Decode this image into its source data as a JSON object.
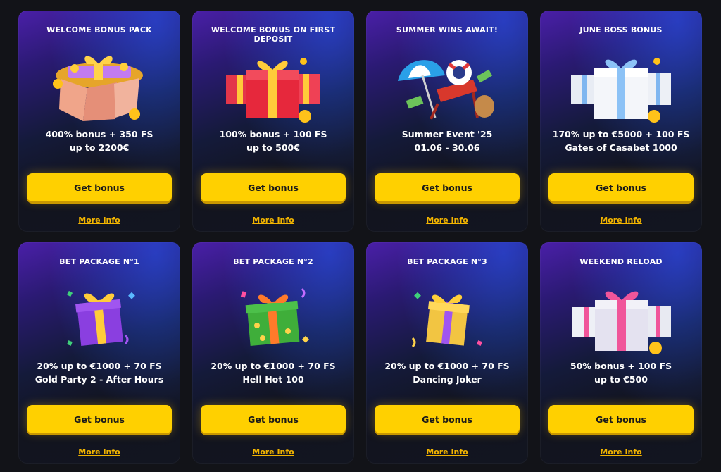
{
  "cards": [
    {
      "title": "WELCOME BONUS PACK",
      "line1": "400% bonus + 350 FS",
      "line2": "up to 2200€",
      "button": "Get bonus",
      "link": "More Info",
      "illustration": "gift-pack-with-gold-icon"
    },
    {
      "title": "WELCOME BONUS ON FIRST DEPOSIT",
      "line1": "100% bonus + 100 FS",
      "line2": "up to 500€",
      "button": "Get bonus",
      "link": "More Info",
      "illustration": "red-gift-boxes-icon"
    },
    {
      "title": "SUMMER WINS AWAIT!",
      "line1": "Summer Event '25",
      "line2": "01.06 - 30.06",
      "button": "Get bonus",
      "link": "More Info",
      "illustration": "beach-chair-umbrella-icon"
    },
    {
      "title": "JUNE BOSS BONUS",
      "line1": "170% up to €5000 + 100 FS",
      "line2": "Gates of Casabet 1000",
      "button": "Get bonus",
      "link": "More Info",
      "illustration": "white-gift-boxes-icon"
    },
    {
      "title": "BET PACKAGE N°1",
      "line1": "20% up to €1000 + 70 FS",
      "line2": "Gold Party 2 - After Hours",
      "button": "Get bonus",
      "link": "More Info",
      "illustration": "purple-gift-box-icon"
    },
    {
      "title": "BET PACKAGE N°2",
      "line1": "20% up to €1000 + 70 FS",
      "line2": "Hell Hot 100",
      "button": "Get bonus",
      "link": "More Info",
      "illustration": "green-gift-box-icon"
    },
    {
      "title": "BET PACKAGE N°3",
      "line1": "20% up to €1000 + 70 FS",
      "line2": "Dancing Joker",
      "button": "Get bonus",
      "link": "More Info",
      "illustration": "gold-gift-box-icon"
    },
    {
      "title": "WEEKEND RELOAD",
      "line1": "50% bonus + 100 FS",
      "line2": "up to €500",
      "button": "Get bonus",
      "link": "More Info",
      "illustration": "pink-white-gift-boxes-icon"
    }
  ],
  "colors": {
    "page_background": "#121318",
    "button": "#ffd000",
    "link": "#f2b400",
    "card_gradient_top": "#4a1fa8"
  }
}
